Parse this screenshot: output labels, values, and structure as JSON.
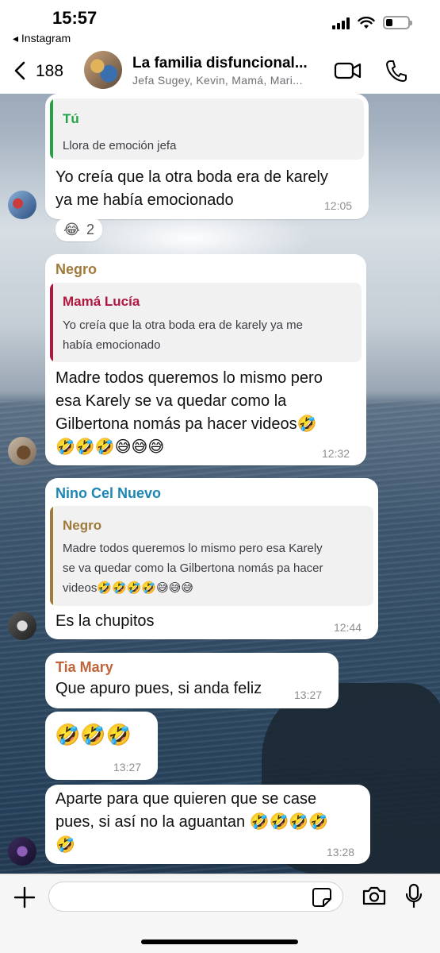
{
  "status_bar": {
    "time": "15:57",
    "back_app": "◂ Instagram",
    "battery_level": 0.3
  },
  "header": {
    "unread_count": "188",
    "title": "La familia disfuncional...",
    "members": "Jefa Sugey, Kevin, Mamá, Mari..."
  },
  "messages": [
    {
      "quote_name": "Tú",
      "quote_text": "Llora de emoción jefa",
      "text_lines": [
        "Yo creía que la otra boda era de karely",
        "ya me había emocionado"
      ],
      "time": "12:05",
      "reaction_emoji": "😂",
      "reaction_count": "2"
    },
    {
      "sender": "Negro",
      "quote_name": "Mamá Lucía",
      "quote_text_lines": [
        "Yo creía que la otra boda era de karely ya me",
        "había emocionado"
      ],
      "text_lines": [
        "Madre todos queremos lo mismo pero",
        "esa Karely se va quedar como la",
        "Gilbertona nomás pa hacer videos🤣",
        "🤣🤣🤣😅😅😅"
      ],
      "time": "12:32"
    },
    {
      "sender": "Nino Cel Nuevo",
      "quote_name": "Negro",
      "quote_text_lines": [
        "Madre todos queremos lo mismo pero esa Karely",
        "se va quedar como la Gilbertona nomás pa hacer",
        "videos🤣🤣🤣🤣😅😅😅"
      ],
      "text_lines": [
        "Es la chupitos"
      ],
      "time": "12:44"
    },
    {
      "sender": "Tia Mary",
      "text_lines": [
        "Que apuro pues, si anda feliz"
      ],
      "time": "13:27"
    },
    {
      "text_lines": [
        "🤣🤣🤣"
      ],
      "time": "13:27"
    },
    {
      "text_lines": [
        "Aparte para que quieren que se case",
        "pues, si así no la aguantan 🤣🤣🤣🤣",
        "🤣"
      ],
      "time": "13:28"
    }
  ],
  "colors": {
    "quote_self": "#25a244",
    "sender_negro": "#a07a3a",
    "quote_mama": "#b0173f",
    "sender_nino": "#1d86b5",
    "sender_tia": "#c0643a"
  },
  "icons": {
    "back": "chevron-left-icon",
    "video": "video-camera-icon",
    "phone": "phone-icon",
    "plus": "plus-icon",
    "sticker": "sticker-icon",
    "camera": "camera-icon",
    "mic": "microphone-icon"
  }
}
